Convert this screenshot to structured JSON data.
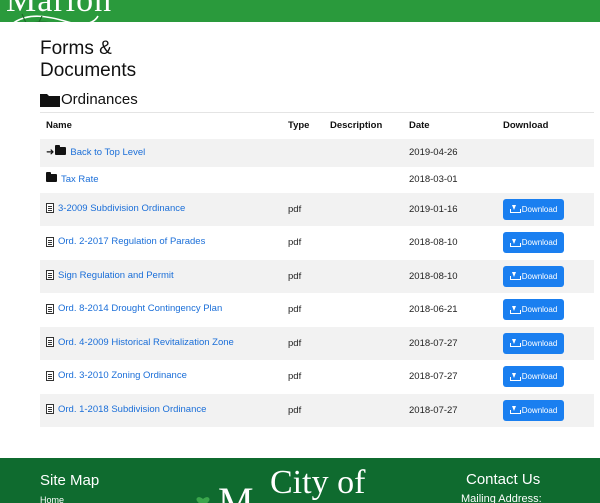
{
  "header": {
    "logo_text": "Marion"
  },
  "page": {
    "title": "Forms & Documents",
    "folder": "Ordinances"
  },
  "table": {
    "headers": {
      "name": "Name",
      "type": "Type",
      "description": "Description",
      "date": "Date",
      "download": "Download"
    },
    "rows": [
      {
        "name": "Back to Top Level",
        "type": "",
        "description": "",
        "date": "2019-04-26",
        "icon": "back-arrow-folder-icon",
        "download": ""
      },
      {
        "name": "Tax Rate",
        "type": "",
        "description": "",
        "date": "2018-03-01",
        "icon": "folder-icon",
        "download": ""
      },
      {
        "name": "3-2009 Subdivision Ordinance",
        "type": "pdf",
        "description": "",
        "date": "2019-01-16",
        "icon": "file-icon",
        "download": "Download"
      },
      {
        "name": "Ord. 2-2017 Regulation of Parades",
        "type": "pdf",
        "description": "",
        "date": "2018-08-10",
        "icon": "file-icon",
        "download": "Download"
      },
      {
        "name": "Sign Regulation and Permit",
        "type": "pdf",
        "description": "",
        "date": "2018-08-10",
        "icon": "file-icon",
        "download": "Download"
      },
      {
        "name": "Ord. 8-2014 Drought Contingency Plan",
        "type": "pdf",
        "description": "",
        "date": "2018-06-21",
        "icon": "file-icon",
        "download": "Download"
      },
      {
        "name": "Ord. 4-2009 Historical Revitalization Zone",
        "type": "pdf",
        "description": "",
        "date": "2018-07-27",
        "icon": "file-icon",
        "download": "Download"
      },
      {
        "name": "Ord. 3-2010 Zoning Ordinance",
        "type": "pdf",
        "description": "",
        "date": "2018-07-27",
        "icon": "file-icon",
        "download": "Download"
      },
      {
        "name": "Ord. 1-2018 Subdivision Ordinance",
        "type": "pdf",
        "description": "",
        "date": "2018-07-27",
        "icon": "file-icon",
        "download": "Download"
      }
    ]
  },
  "footer": {
    "sitemap_title": "Site Map",
    "sitemap_home": "Home",
    "city_text": "City of",
    "city_initial": "M",
    "contact_title": "Contact Us",
    "mailing": "Mailing Address:"
  },
  "colors": {
    "header_green": "#2a9a3c",
    "footer_green": "#0f6b2f",
    "link_blue": "#1a6ed8",
    "button_blue": "#1a7ff0"
  }
}
